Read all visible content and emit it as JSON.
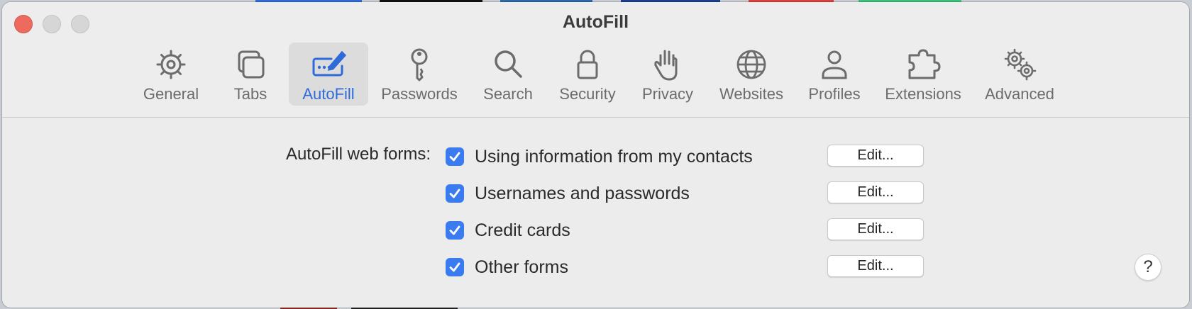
{
  "window": {
    "title": "AutoFill"
  },
  "tabs": [
    {
      "label": "General",
      "icon": "gear-icon"
    },
    {
      "label": "Tabs",
      "icon": "tabs-icon"
    },
    {
      "label": "AutoFill",
      "icon": "autofill-icon",
      "selected": true
    },
    {
      "label": "Passwords",
      "icon": "key-icon"
    },
    {
      "label": "Search",
      "icon": "search-icon"
    },
    {
      "label": "Security",
      "icon": "lock-icon"
    },
    {
      "label": "Privacy",
      "icon": "hand-icon"
    },
    {
      "label": "Websites",
      "icon": "globe-icon"
    },
    {
      "label": "Profiles",
      "icon": "person-icon"
    },
    {
      "label": "Extensions",
      "icon": "puzzle-icon"
    },
    {
      "label": "Advanced",
      "icon": "gears-icon"
    }
  ],
  "autofill": {
    "label": "AutoFill web forms:",
    "options": [
      {
        "label": "Using information from my contacts",
        "checked": true,
        "button": "Edit..."
      },
      {
        "label": "Usernames and passwords",
        "checked": true,
        "button": "Edit..."
      },
      {
        "label": "Credit cards",
        "checked": true,
        "button": "Edit..."
      },
      {
        "label": "Other forms",
        "checked": true,
        "button": "Edit..."
      }
    ]
  },
  "help": {
    "label": "?"
  },
  "colors": {
    "accent": "#2f6bd8",
    "checkbox": "#3a7cf0",
    "close_button": "#ed6a5e",
    "window_bg": "#ececec"
  }
}
